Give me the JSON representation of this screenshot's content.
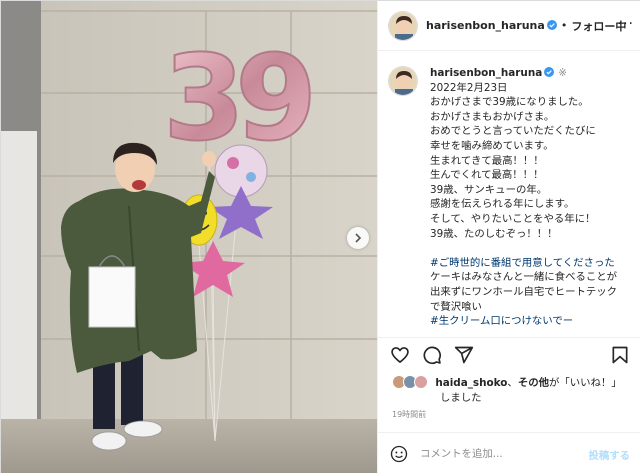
{
  "header": {
    "username": "harisenbon_haruna",
    "follow_label": "フォロー中",
    "dot": "•",
    "more": "···"
  },
  "caption": {
    "username": "harisenbon_haruna",
    "asterisk": "※",
    "lines": [
      "2022年2月23日",
      "おかげさまで39歳になりました。",
      "おかげさまもおかげさま。",
      "おめでとうと言っていただくたびに",
      "幸せを噛み締めています。",
      "生まれてきて最高！！！",
      "生んでくれて最高！！！",
      "39歳、サンキューの年。",
      "感謝を伝えられる年にします。",
      "そして、やりたいことをやる年に！",
      "39歳、たのしむぞっ！！！"
    ],
    "tags": [
      "#ご時世的に番組で用意してくださった",
      "ケーキはみなさんと一緒に食べることが",
      "出来ずにワンホール自宅でヒートテック",
      "で贅沢喰い",
      "#生クリーム口につけないでー",
      "#…"
    ]
  },
  "photo": {
    "balloon_number": "39"
  },
  "likes": {
    "user": "haida_shoko",
    "connector": "、",
    "others": "その他",
    "suffix": "が「いいね！」",
    "suffix2": "しました"
  },
  "time": "19時間前",
  "comment": {
    "placeholder": "コメントを追加...",
    "post_label": "投稿する"
  },
  "colors": {
    "verified": "#3897f0",
    "hashtag": "#00376b",
    "post_button": "#b2dffc",
    "secondary_text": "#8e8e8e"
  },
  "icons": [
    "verified-icon",
    "more-icon",
    "heart-icon",
    "comment-icon",
    "share-icon",
    "bookmark-icon",
    "emoji-icon",
    "chevron-right-icon"
  ]
}
